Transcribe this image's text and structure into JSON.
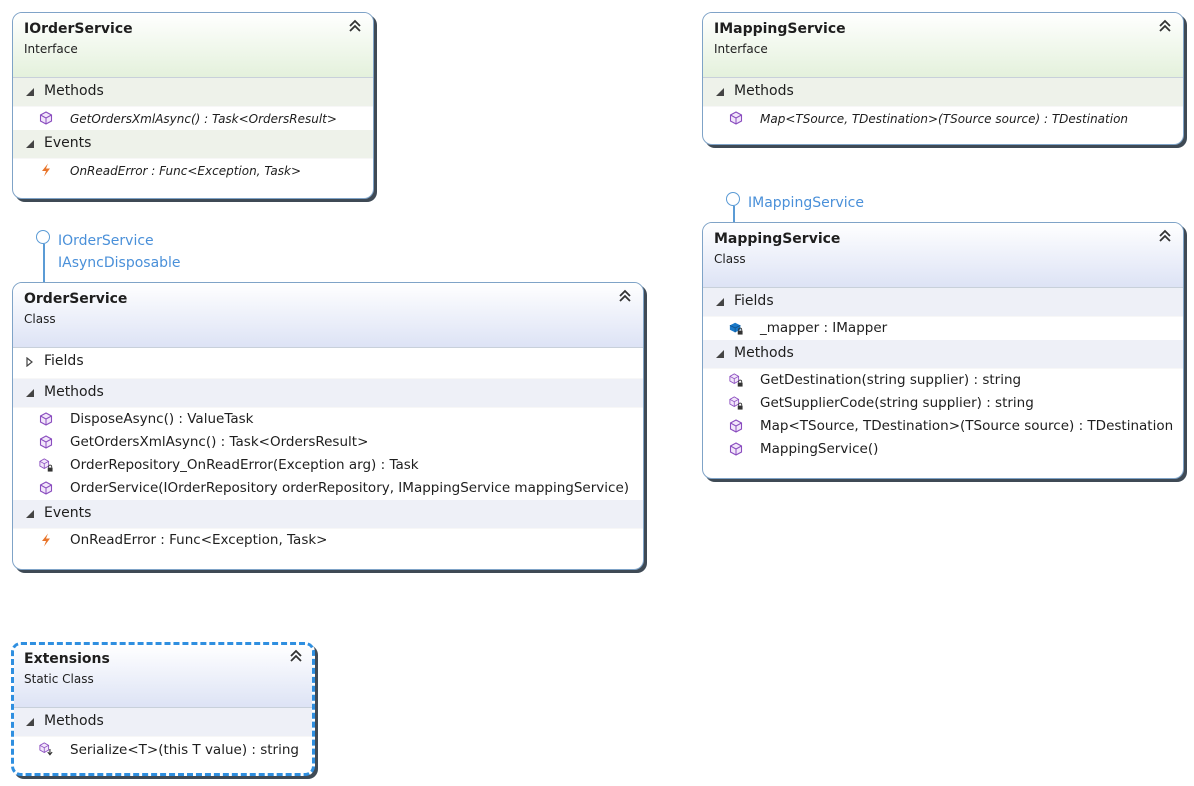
{
  "iorderservice": {
    "name": "IOrderService",
    "kind": "Interface",
    "sections": [
      {
        "label": "Methods",
        "members": [
          {
            "text": "GetOrdersXmlAsync() : Task<OrdersResult>",
            "icon": "method-icon"
          }
        ]
      },
      {
        "label": "Events",
        "members": [
          {
            "text": "OnReadError : Func<Exception, Task>",
            "icon": "event-icon"
          }
        ]
      }
    ]
  },
  "imappingservice": {
    "name": "IMappingService",
    "kind": "Interface",
    "sections": [
      {
        "label": "Methods",
        "members": [
          {
            "text": "Map<TSource, TDestination>(TSource source) : TDestination",
            "icon": "method-icon"
          }
        ]
      }
    ]
  },
  "orderservice": {
    "name": "OrderService",
    "kind": "Class",
    "interfaces": [
      "IOrderService",
      "IAsyncDisposable"
    ],
    "sections": [
      {
        "label": "Fields",
        "collapsed": true,
        "members": []
      },
      {
        "label": "Methods",
        "members": [
          {
            "text": "DisposeAsync() : ValueTask",
            "icon": "method-icon"
          },
          {
            "text": "GetOrdersXmlAsync() : Task<OrdersResult>",
            "icon": "method-icon"
          },
          {
            "text": "OrderRepository_OnReadError(Exception arg) : Task",
            "icon": "private-method-icon"
          },
          {
            "text": "OrderService(IOrderRepository orderRepository, IMappingService mappingService)",
            "icon": "method-icon"
          }
        ]
      },
      {
        "label": "Events",
        "members": [
          {
            "text": "OnReadError : Func<Exception, Task>",
            "icon": "event-icon"
          }
        ]
      }
    ]
  },
  "mappingservice": {
    "name": "MappingService",
    "kind": "Class",
    "interfaces": [
      "IMappingService"
    ],
    "sections": [
      {
        "label": "Fields",
        "members": [
          {
            "text": "_mapper : IMapper",
            "icon": "private-field-icon"
          }
        ]
      },
      {
        "label": "Methods",
        "members": [
          {
            "text": "GetDestination(string supplier) : string",
            "icon": "private-method-icon"
          },
          {
            "text": "GetSupplierCode(string supplier) : string",
            "icon": "private-method-icon"
          },
          {
            "text": "Map<TSource, TDestination>(TSource source) : TDestination",
            "icon": "method-icon"
          },
          {
            "text": "MappingService()",
            "icon": "method-icon"
          }
        ]
      }
    ]
  },
  "extensions": {
    "name": "Extensions",
    "kind": "Static Class",
    "sections": [
      {
        "label": "Methods",
        "members": [
          {
            "text": "Serialize<T>(this T value) : string",
            "icon": "extension-method-icon"
          }
        ]
      }
    ]
  }
}
